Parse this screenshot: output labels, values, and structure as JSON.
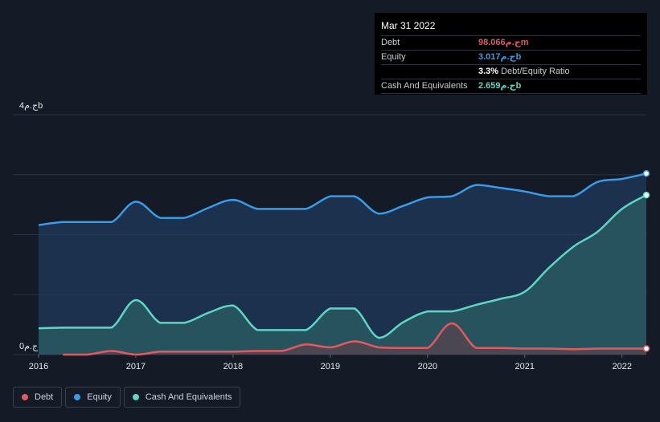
{
  "tooltip": {
    "date": "Mar 31 2022",
    "rows": [
      {
        "label": "Debt",
        "value": "98.066ج.مm",
        "color": "#e05a5f",
        "extra": ""
      },
      {
        "label": "Equity",
        "value": "3.017ج.مb",
        "color": "#3a9be8",
        "extra": ""
      },
      {
        "label": "",
        "value": "3.3%",
        "color": "#ffffff",
        "extra": "Debt/Equity Ratio"
      },
      {
        "label": "Cash And Equivalents",
        "value": "2.659ج.مb",
        "color": "#5fd6c4",
        "extra": ""
      }
    ]
  },
  "y_axis": {
    "top_label": "4ج.مb",
    "bottom_label": "0ج.م"
  },
  "legend": [
    {
      "label": "Debt",
      "color": "#e05a5f"
    },
    {
      "label": "Equity",
      "color": "#3a9be8"
    },
    {
      "label": "Cash And Equivalents",
      "color": "#5fd6c4"
    }
  ],
  "chart_data": {
    "type": "area",
    "x_ticks": [
      "2016",
      "2017",
      "2018",
      "2019",
      "2020",
      "2021",
      "2022"
    ],
    "ylim": [
      0,
      4
    ],
    "y_unit": "ج.مb",
    "grid": true,
    "legend_placement": "bottom-left",
    "series": [
      {
        "name": "Equity",
        "color": "#3a9be8",
        "x": [
          2016.0,
          2016.25,
          2016.5,
          2016.75,
          2017.0,
          2017.25,
          2017.5,
          2017.75,
          2018.0,
          2018.25,
          2018.5,
          2018.75,
          2019.0,
          2019.25,
          2019.5,
          2019.75,
          2020.0,
          2020.25,
          2020.5,
          2020.75,
          2021.0,
          2021.25,
          2021.5,
          2021.75,
          2022.0,
          2022.25
        ],
        "values": [
          2.16,
          2.21,
          2.21,
          2.21,
          2.55,
          2.28,
          2.28,
          2.45,
          2.58,
          2.43,
          2.43,
          2.43,
          2.64,
          2.64,
          2.35,
          2.48,
          2.62,
          2.64,
          2.83,
          2.78,
          2.72,
          2.64,
          2.64,
          2.88,
          2.93,
          3.02
        ]
      },
      {
        "name": "Cash And Equivalents",
        "color": "#5fd6c4",
        "x": [
          2016.0,
          2016.25,
          2016.5,
          2016.75,
          2017.0,
          2017.25,
          2017.5,
          2017.75,
          2018.0,
          2018.25,
          2018.5,
          2018.75,
          2019.0,
          2019.25,
          2019.5,
          2019.75,
          2020.0,
          2020.25,
          2020.5,
          2020.75,
          2021.0,
          2021.25,
          2021.5,
          2021.75,
          2022.0,
          2022.25
        ],
        "values": [
          0.44,
          0.45,
          0.45,
          0.45,
          0.91,
          0.53,
          0.53,
          0.7,
          0.82,
          0.41,
          0.41,
          0.41,
          0.77,
          0.77,
          0.28,
          0.54,
          0.72,
          0.72,
          0.83,
          0.93,
          1.05,
          1.45,
          1.8,
          2.05,
          2.43,
          2.66
        ]
      },
      {
        "name": "Debt",
        "color": "#e05a5f",
        "x": [
          2016.25,
          2016.5,
          2016.75,
          2017.0,
          2017.25,
          2017.5,
          2017.75,
          2018.0,
          2018.25,
          2018.5,
          2018.75,
          2019.0,
          2019.25,
          2019.5,
          2019.75,
          2020.0,
          2020.25,
          2020.5,
          2020.75,
          2021.0,
          2021.25,
          2021.5,
          2021.75,
          2022.0,
          2022.25
        ],
        "values": [
          0.0,
          0.0,
          0.06,
          0.0,
          0.05,
          0.05,
          0.05,
          0.05,
          0.06,
          0.06,
          0.17,
          0.12,
          0.22,
          0.12,
          0.11,
          0.11,
          0.52,
          0.11,
          0.11,
          0.1,
          0.1,
          0.09,
          0.1,
          0.1,
          0.1
        ]
      }
    ]
  }
}
